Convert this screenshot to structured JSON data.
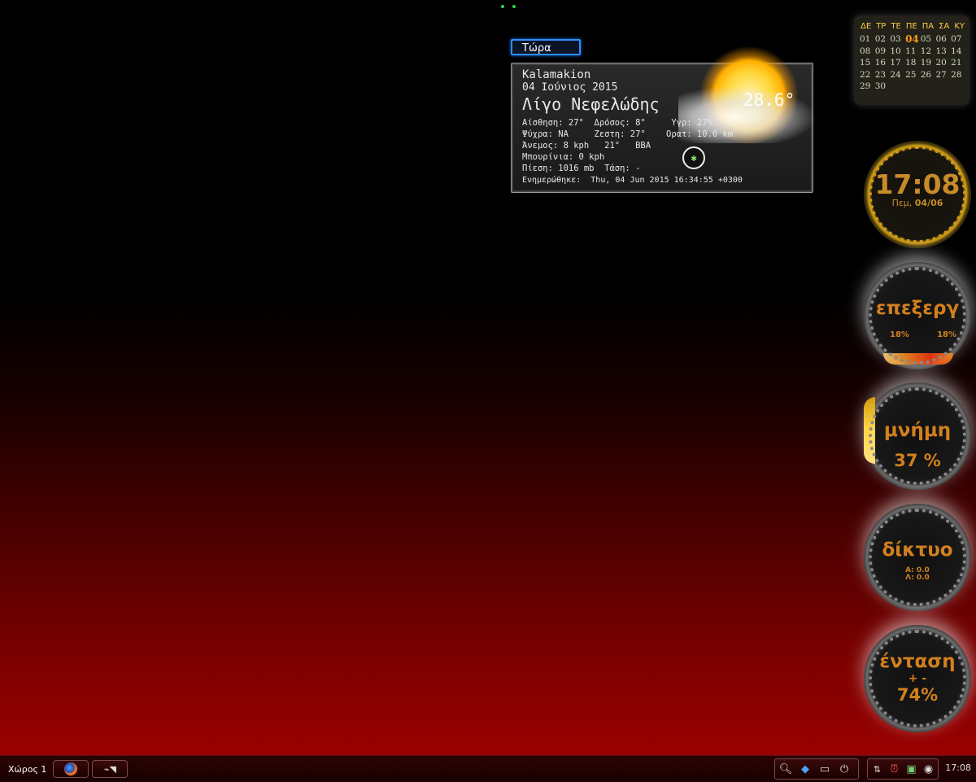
{
  "weather": {
    "tab_label": "Τώρα",
    "city": "Kalamakion",
    "date": "04 Ιούνιος 2015",
    "condition": "Λίγο Νεφελώδης",
    "temperature": "28.6°",
    "row1": "Αίσθηση: 27°  Δρόσος: 8°     Υγρ: 27%",
    "row2": "Ψύχρα: NA     Ζεστη: 27°    Ορατ: 10.0 km",
    "row3": "Άνεμος: 8 kph   21°   ΒΒΑ",
    "row4": "Μπουρίνια: 0 kph",
    "row5": "Πίεση: 1016 mb  Τάση: -",
    "updated": "Ενημερώθηκε:  Thu, 04 Jun 2015 16:34:55 +0300"
  },
  "calendar": {
    "weekdays": [
      "ΔΕ",
      "ΤΡ",
      "ΤΕ",
      "ΠΕ",
      "ΠΑ",
      "ΣΑ",
      "ΚΥ"
    ],
    "days": [
      "01",
      "02",
      "03",
      "04",
      "05",
      "06",
      "07",
      "08",
      "09",
      "10",
      "11",
      "12",
      "13",
      "14",
      "15",
      "16",
      "17",
      "18",
      "19",
      "20",
      "21",
      "22",
      "23",
      "24",
      "25",
      "26",
      "27",
      "28",
      "29",
      "30"
    ],
    "today": "04"
  },
  "clock": {
    "time": "17:08",
    "day": "Πεμ,",
    "date": "04/06"
  },
  "cpu": {
    "label": "επεξεργ",
    "core1": "18%",
    "core2": "18%"
  },
  "memory": {
    "label": "μνήμη",
    "value": "37 %",
    "level_percent": 37
  },
  "network": {
    "label": "δίκτυο",
    "down": "Α: 0.0",
    "up": "Λ: 0.0"
  },
  "volume": {
    "label": "ένταση",
    "controls": "+ -",
    "value": "74%"
  },
  "taskbar": {
    "workspace": "Χώρος 1",
    "time": "17:08"
  },
  "icons": {
    "firefox": "firefox-icon",
    "screenshot": "screenshot-icon",
    "search": "search-icon",
    "kde": "kde-icon",
    "terminal": "terminal-icon",
    "power": "power-icon",
    "network": "network-icon",
    "alarm": "alarm-icon",
    "monitor": "monitor-icon",
    "volume": "volume-icon"
  },
  "colors": {
    "accent": "#d2801e",
    "focus": "#2a8fff"
  }
}
